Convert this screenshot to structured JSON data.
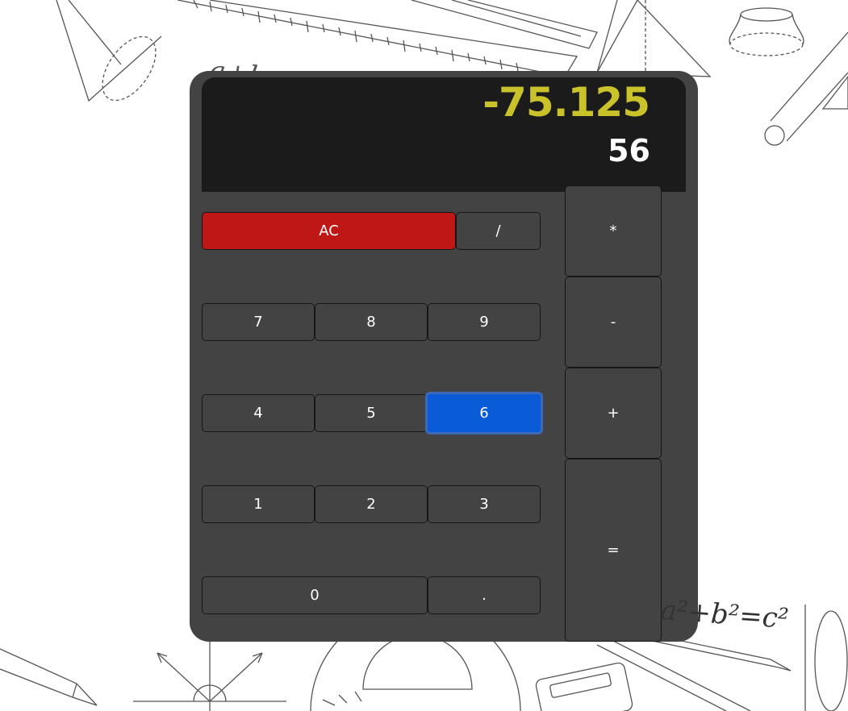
{
  "display": {
    "previous": "-75.125",
    "current": "56"
  },
  "buttons": {
    "ac": "AC",
    "divide": "/",
    "multiply": "*",
    "subtract": "-",
    "add": "+",
    "equals": "=",
    "seven": "7",
    "eight": "8",
    "nine": "9",
    "four": "4",
    "five": "5",
    "six": "6",
    "one": "1",
    "two": "2",
    "three": "3",
    "zero": "0",
    "decimal": "."
  },
  "background": {
    "formula_top": "a+b=c",
    "formula_bottom": "a²+b²=c²"
  },
  "colors": {
    "body": "#434343",
    "display": "#1b1b1b",
    "previous_text": "#c9c22a",
    "clear_button": "#be1716",
    "active_button": "#0a5bd8"
  }
}
